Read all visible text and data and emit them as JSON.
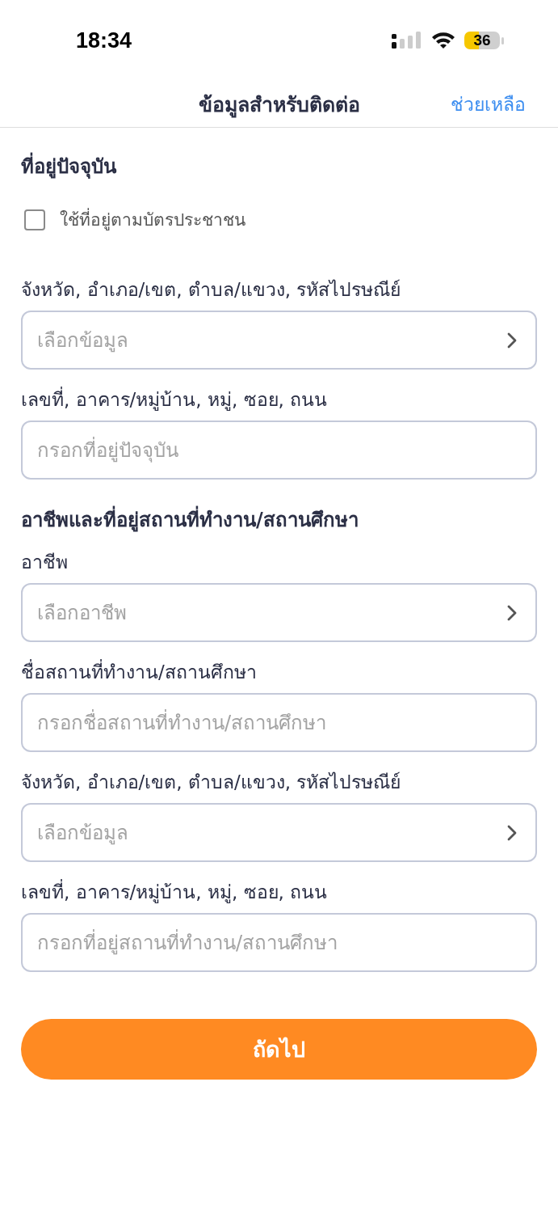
{
  "status_bar": {
    "time": "18:34",
    "battery": "36"
  },
  "nav": {
    "title": "ข้อมูลสำหรับติดต่อ",
    "action": "ช่วยเหลือ"
  },
  "sections": [
    {
      "title": "ที่อยู่ปัจจุบัน",
      "checkbox": {
        "label": "ใช้ที่อยู่ตามบัตรประชาชน",
        "checked": false
      },
      "fields": [
        {
          "kind": "select",
          "label": "จังหวัด, อำเภอ/เขต, ตำบล/แขวง, รหัสไปรษณีย์",
          "placeholder": "เลือกข้อมูล"
        },
        {
          "kind": "text",
          "label": "เลขที่, อาคาร/หมู่บ้าน, หมู่, ซอย, ถนน",
          "placeholder": "กรอกที่อยู่ปัจจุบัน"
        }
      ]
    },
    {
      "title": "อาชีพและที่อยู่สถานที่ทำงาน/สถานศึกษา",
      "fields": [
        {
          "kind": "select",
          "label": "อาชีพ",
          "placeholder": "เลือกอาชีพ"
        },
        {
          "kind": "text",
          "label": "ชื่อสถานที่ทำงาน/สถานศึกษา",
          "placeholder": "กรอกชื่อสถานที่ทำงาน/สถานศึกษา"
        },
        {
          "kind": "select",
          "label": "จังหวัด, อำเภอ/เขต, ตำบล/แขวง, รหัสไปรษณีย์",
          "placeholder": "เลือกข้อมูล"
        },
        {
          "kind": "text",
          "label": "เลขที่, อาคาร/หมู่บ้าน, หมู่, ซอย, ถนน",
          "placeholder": "กรอกที่อยู่สถานที่ทำงาน/สถานศึกษา"
        }
      ]
    }
  ],
  "button": "ถัดไป"
}
